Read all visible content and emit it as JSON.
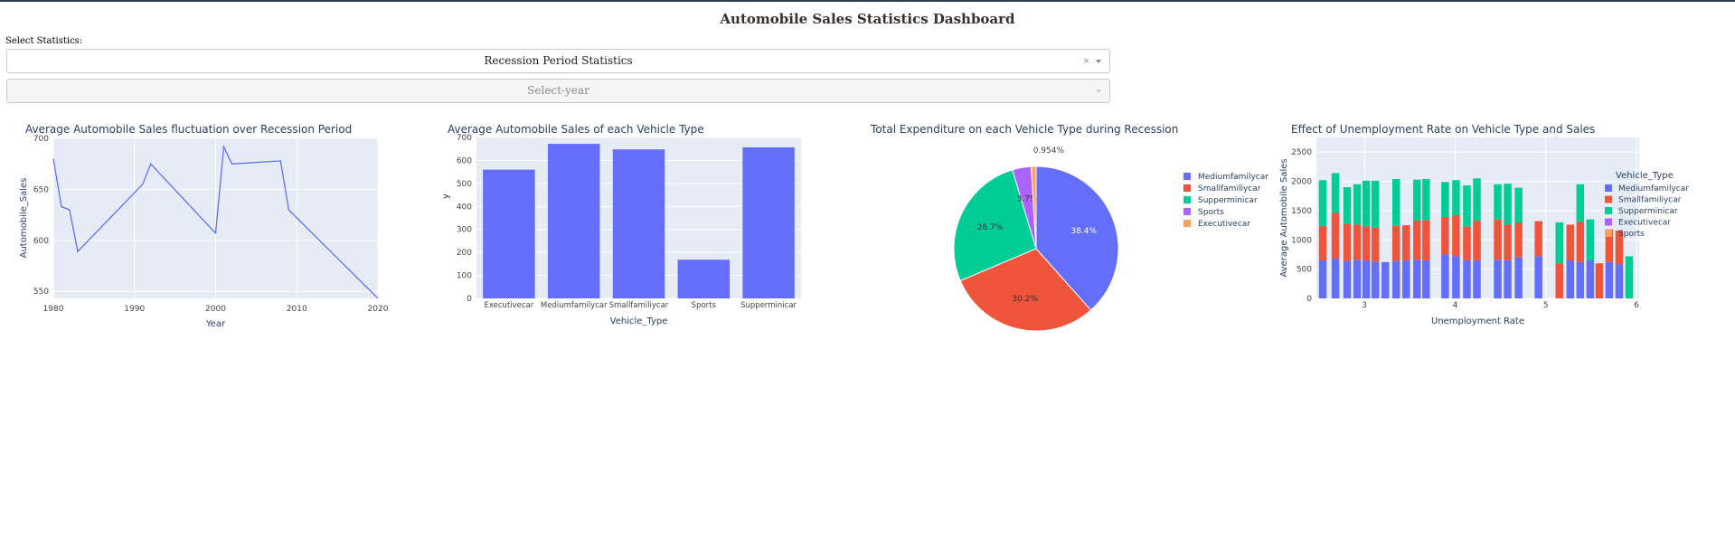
{
  "header": {
    "title": "Automobile Sales Statistics Dashboard"
  },
  "controls": {
    "select_label": "Select Statistics:",
    "statistics_dropdown": {
      "value": "Recession Period Statistics",
      "clear_icon": "×"
    },
    "year_dropdown": {
      "placeholder": "Select-year"
    }
  },
  "colors": {
    "blue": "#636efa",
    "red": "#ef553b",
    "green": "#00cc96",
    "purple": "#ab63fa",
    "orange": "#ffa15a",
    "plot_bg": "#e5ecf6",
    "text": "#2a3f5f"
  },
  "chart_data": [
    {
      "type": "line",
      "title": "Average Automobile Sales fluctuation over Recession Period",
      "xlabel": "Year",
      "ylabel": "Automobile_Sales",
      "xlim": [
        1980,
        2020
      ],
      "ylim": [
        543,
        701
      ],
      "xticks": [
        1980,
        1990,
        2000,
        2010,
        2020
      ],
      "yticks": [
        550,
        600,
        650,
        700
      ],
      "x": [
        1980,
        1981,
        1982,
        1983,
        1991,
        1992,
        2000,
        2001,
        2002,
        2008,
        2009,
        2020
      ],
      "y": [
        680,
        633,
        630,
        589,
        655,
        675,
        607,
        692,
        675,
        678,
        630,
        543
      ]
    },
    {
      "type": "bar",
      "title": "Average Automobile Sales of each Vehicle Type",
      "xlabel": "Vehicle_Type",
      "ylabel": "y",
      "ylim": [
        0,
        700
      ],
      "yticks": [
        0,
        100,
        200,
        300,
        400,
        500,
        600,
        700
      ],
      "categories": [
        "Executivecar",
        "Mediumfamilycar",
        "Smallfamiliycar",
        "Sports",
        "Supperminicar"
      ],
      "values": [
        560,
        672,
        648,
        168,
        657
      ]
    },
    {
      "type": "pie",
      "title": "Total Expenditure on each Vehicle Type during Recession",
      "labels": [
        "Mediumfamilycar",
        "Smallfamiliycar",
        "Supperminicar",
        "Sports",
        "Executivecar"
      ],
      "values": [
        38.4,
        30.2,
        26.7,
        3.7,
        0.954
      ],
      "slice_labels": [
        "38.4%",
        "30.2%",
        "26.7%",
        "3.7%",
        "0.954%"
      ],
      "legend": "right"
    },
    {
      "type": "bar",
      "stacked": true,
      "title": "Effect of Unemployment Rate on Vehicle Type and Sales",
      "xlabel": "Unemployment Rate",
      "ylabel": "Average Automobile Sales",
      "legend_title": "Vehicle_Type",
      "xlim": [
        2.47,
        6.03
      ],
      "ylim": [
        0,
        2750
      ],
      "xticks": [
        3,
        4,
        5,
        6
      ],
      "yticks": [
        0,
        500,
        1000,
        1500,
        2000,
        2500
      ],
      "x": [
        2.54,
        2.68,
        2.81,
        2.92,
        3.02,
        3.12,
        3.23,
        3.35,
        3.46,
        3.58,
        3.68,
        3.78,
        3.89,
        4.01,
        4.13,
        4.24,
        4.36,
        4.47,
        4.58,
        4.7,
        4.81,
        4.92,
        5.03,
        5.15,
        5.27,
        5.38,
        5.49,
        5.59,
        5.7,
        5.81,
        5.92
      ],
      "series": [
        {
          "name": "Mediumfamilycar",
          "values": [
            650,
            680,
            640,
            660,
            650,
            630,
            620,
            640,
            650,
            660,
            650,
            0,
            750,
            720,
            650,
            650,
            0,
            660,
            650,
            700,
            0,
            720,
            0,
            0,
            650,
            620,
            650,
            0,
            620,
            580,
            0
          ]
        },
        {
          "name": "Smallfamiliycar",
          "values": [
            590,
            780,
            630,
            600,
            580,
            580,
            0,
            600,
            600,
            670,
            690,
            0,
            640,
            700,
            580,
            680,
            0,
            690,
            610,
            590,
            0,
            600,
            0,
            600,
            610,
            690,
            0,
            600,
            560,
            580,
            0
          ]
        },
        {
          "name": "Supperminicar",
          "values": [
            780,
            680,
            630,
            690,
            780,
            800,
            0,
            800,
            0,
            700,
            700,
            0,
            600,
            600,
            700,
            720,
            0,
            600,
            700,
            600,
            0,
            0,
            0,
            700,
            0,
            640,
            700,
            0,
            0,
            0,
            720
          ]
        },
        {
          "name": "Executivecar",
          "values": [
            0,
            0,
            0,
            0,
            0,
            0,
            0,
            0,
            0,
            0,
            0,
            0,
            0,
            0,
            0,
            0,
            0,
            0,
            0,
            0,
            0,
            0,
            0,
            0,
            0,
            0,
            0,
            0,
            0,
            0,
            0
          ]
        },
        {
          "name": "Sports",
          "values": [
            0,
            0,
            0,
            0,
            0,
            0,
            0,
            0,
            0,
            0,
            0,
            0,
            0,
            0,
            0,
            0,
            0,
            0,
            0,
            0,
            0,
            0,
            0,
            0,
            0,
            0,
            0,
            0,
            0,
            0,
            0
          ]
        }
      ]
    }
  ]
}
